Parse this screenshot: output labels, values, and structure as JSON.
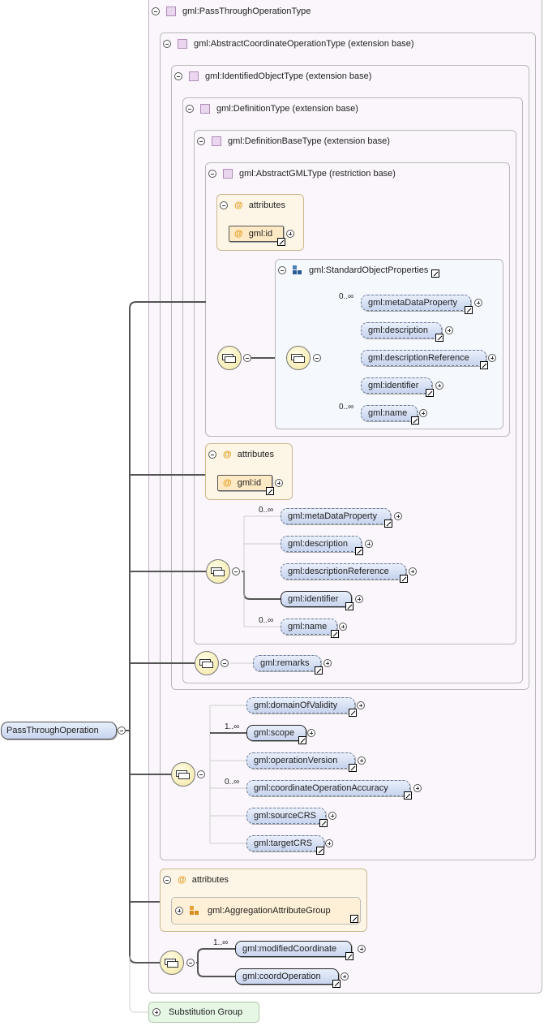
{
  "root": {
    "element": "PassThroughOperation"
  },
  "types": {
    "pass_through": "gml:PassThroughOperationType",
    "abstract_coord_op": "gml:AbstractCoordinateOperationType (extension base)",
    "identified_object": "gml:IdentifiedObjectType (extension base)",
    "definition": "gml:DefinitionType (extension base)",
    "definition_base": "gml:DefinitionBaseType (extension base)",
    "abstract_gml": "gml:AbstractGMLType (restriction base)"
  },
  "attributes_label": "attributes",
  "attr_id": "gml:id",
  "standard_object_properties": {
    "title": "gml:StandardObjectProperties",
    "items": [
      {
        "name": "gml:metaDataProperty",
        "card": "0..∞"
      },
      {
        "name": "gml:description",
        "card": ""
      },
      {
        "name": "gml:descriptionReference",
        "card": ""
      },
      {
        "name": "gml:identifier",
        "card": ""
      },
      {
        "name": "gml:name",
        "card": "0..∞"
      }
    ]
  },
  "definition_base_seq": [
    {
      "name": "gml:metaDataProperty",
      "card": "0..∞"
    },
    {
      "name": "gml:description",
      "card": ""
    },
    {
      "name": "gml:descriptionReference",
      "card": ""
    },
    {
      "name": "gml:identifier",
      "card": ""
    },
    {
      "name": "gml:name",
      "card": "0..∞"
    }
  ],
  "remarks": "gml:remarks",
  "coord_op_seq": [
    {
      "name": "gml:domainOfValidity",
      "card": ""
    },
    {
      "name": "gml:scope",
      "card": "1..∞"
    },
    {
      "name": "gml:operationVersion",
      "card": ""
    },
    {
      "name": "gml:coordinateOperationAccuracy",
      "card": "0..∞"
    },
    {
      "name": "gml:sourceCRS",
      "card": ""
    },
    {
      "name": "gml:targetCRS",
      "card": ""
    }
  ],
  "aggregation_group": "gml:AggregationAttributeGroup",
  "pass_seq": [
    {
      "name": "gml:modifiedCoordinate",
      "card": "1..∞"
    },
    {
      "name": "gml:coordOperation",
      "card": ""
    }
  ],
  "substitution_group": "Substitution Group",
  "colors": {
    "element_fill": "#c7d4ee",
    "attr_fill": "#fde9c4",
    "type_fill": "#faf6fb"
  }
}
